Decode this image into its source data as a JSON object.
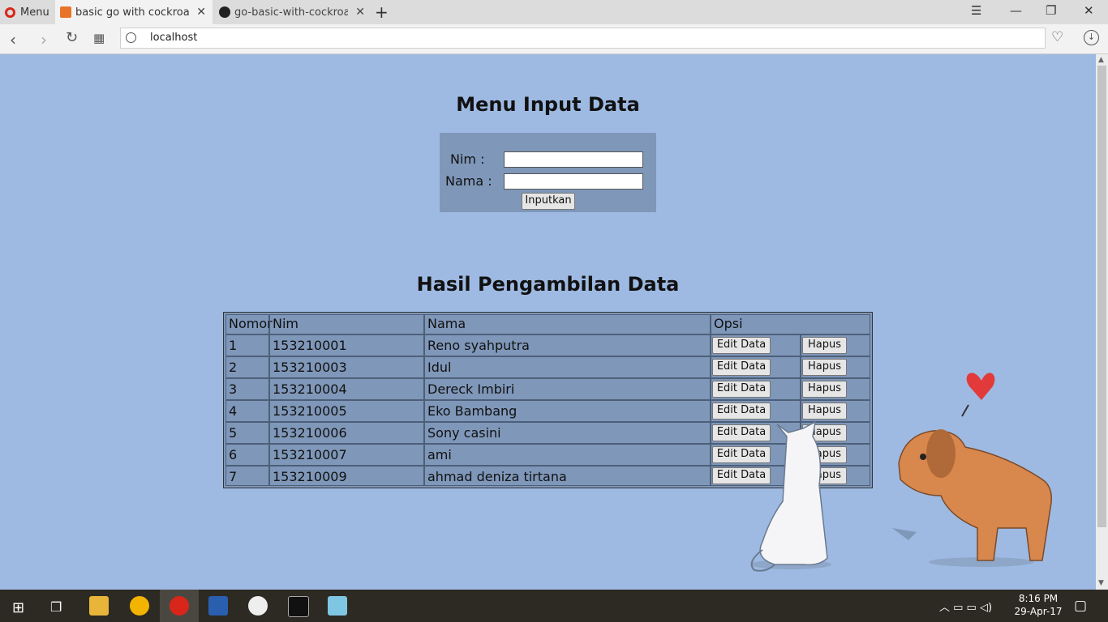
{
  "browser": {
    "menu_label": "Menu",
    "tabs": [
      {
        "title": "basic go with cockroachDB"
      },
      {
        "title": "go-basic-with-cockroachDB"
      }
    ],
    "url": "localhost"
  },
  "form": {
    "title": "Menu Input Data",
    "nim_label": "Nim :",
    "nama_label": "Nama :",
    "nim_value": "",
    "nama_value": "",
    "submit_label": "Inputkan"
  },
  "results": {
    "title": "Hasil Pengambilan Data",
    "headers": [
      "Nomor",
      "Nim",
      "Nama",
      "Opsi"
    ],
    "edit_label": "Edit Data",
    "delete_label": "Hapus",
    "rows": [
      {
        "no": "1",
        "nim": "153210001",
        "nama": "Reno syahputra"
      },
      {
        "no": "2",
        "nim": "153210003",
        "nama": "Idul"
      },
      {
        "no": "3",
        "nim": "153210004",
        "nama": "Dereck Imbiri"
      },
      {
        "no": "4",
        "nim": "153210005",
        "nama": "Eko Bambang"
      },
      {
        "no": "5",
        "nim": "153210006",
        "nama": "Sony casini"
      },
      {
        "no": "6",
        "nim": "153210007",
        "nama": "ami"
      },
      {
        "no": "7",
        "nim": "153210009",
        "nama": "ahmad deniza tirtana"
      }
    ]
  },
  "taskbar": {
    "time": "8:16 PM",
    "date": "29-Apr-17"
  },
  "colors": {
    "page_bg": "#9ebae3",
    "panel_bg": "#7f97b9",
    "opera_red": "#d8261a"
  }
}
